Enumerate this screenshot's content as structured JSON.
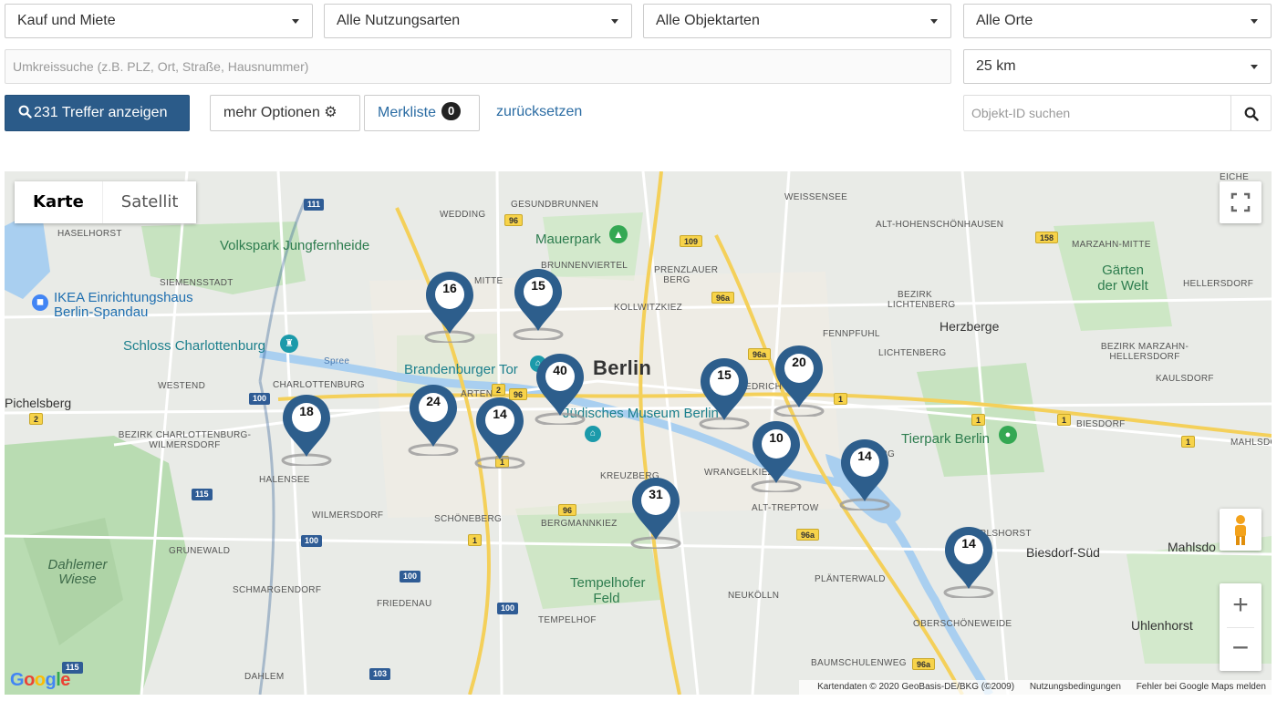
{
  "filters": {
    "row1": [
      "Kauf und Miete",
      "Alle Nutzungsarten",
      "Alle Objektarten",
      "Alle Orte"
    ],
    "radius_placeholder": "Umkreissuche (z.B. PLZ, Ort, Straße, Hausnummer)",
    "radius_value": "25 km"
  },
  "actions": {
    "show_results": "231 Treffer anzeigen",
    "more_options": "mehr Optionen",
    "watchlist": "Merkliste",
    "watchlist_count": "0",
    "reset": "zurücksetzen",
    "object_id_placeholder": "Objekt-ID suchen"
  },
  "map": {
    "type_map": "Karte",
    "type_satellite": "Satellit",
    "attribution": "Kartendaten © 2020 GeoBasis-DE/BKG (©2009)",
    "terms": "Nutzungsbedingungen",
    "report": "Fehler bei Google Maps melden",
    "logo": "Google",
    "clusters": [
      "16",
      "15",
      "40",
      "15",
      "20",
      "18",
      "24",
      "14",
      "10",
      "14",
      "31",
      "14"
    ],
    "colors": {
      "marker": "#2d5e8c",
      "water": "#a9cff0",
      "park": "#c7e3c0",
      "road": "#ffffff",
      "highway": "#f7d34a"
    },
    "labels": {
      "berlin": "Berlin",
      "volkspark": "Volkspark Jungfernheide",
      "ikea": "IKEA Einrichtungshaus Berlin-Spandau",
      "schloss": "Schloss Charlottenburg",
      "brandenburger": "Brandenburger Tor",
      "museum": "Jüdisches Museum Berlin",
      "mauerpark": "Mauerpark",
      "tierpark": "Tierpark Berlin",
      "gaerten": "Gärten der Welt",
      "herzberge": "Herzberge",
      "tempelhof": "Tempelhofer Feld",
      "dahlem_wiese": "Dahlemer Wiese",
      "pichelsberg": "Pichelsberg",
      "biesdorf_sued": "Biesdorf-Süd",
      "uhlenhorst": "Uhlenhorst",
      "mahlsdo": "Mahlsdo",
      "spree": "Spree",
      "wedding": "WEDDING",
      "gesundbrunnen": "GESUNDBRUNNEN",
      "weissensee": "WEISSENSEE",
      "hohenschoenhausen": "ALT-HOHENSCHÖNHAUSEN",
      "marzahn_mitte": "MARZAHN-MITTE",
      "eiche": "EICHE",
      "haselhorst": "HASELHORST",
      "siemensstadt": "SIEMENSSTADT",
      "brunnenviertel": "BRUNNENVIERTEL",
      "prenzlauer": "PRENZLAUER BERG",
      "kollwitzkiez": "KOLLWITZKIEZ",
      "mitte": "MITTE",
      "fennpfuhl": "FENNPFUHL",
      "lichtenberg_bezirk": "BEZIRK LICHTENBERG",
      "lichtenberg": "LICHTENBERG",
      "hellersdorf": "HELLERSDORF",
      "marzahn_hellersdorf": "BEZIRK MARZAHN-HELLERSDORF",
      "kaulsdorf": "KAULSDORF",
      "biesdorf": "BIESDORF",
      "mahlsdorf": "MAHLSDORF",
      "westend": "WESTEND",
      "charlottenburg": "CHARLOTTENBURG",
      "charl_wilm": "BEZIRK CHARLOTTENBURG-WILMERSDORF",
      "halensee": "HALENSEE",
      "wilmersdorf": "WILMERSDORF",
      "grunewald": "GRUNEWALD",
      "schmargendorf": "SCHMARGENDORF",
      "dahlem": "DAHLEM",
      "friedenau": "FRIEDENAU",
      "schoeneberg": "SCHÖNEBERG",
      "tempelhof_d": "TEMPELHOF",
      "kreuzberg": "KREUZBERG",
      "bergmannkiez": "BERGMANNKIEZ",
      "wrangelkiez": "WRANGELKIEZ",
      "alt_treptow": "ALT-TREPTOW",
      "plaenterwald": "PLÄNTERWALD",
      "neukoelln": "NEUKÖLLN",
      "oberschoeneweide": "OBERSCHÖNEWEIDE",
      "baumschulenweg": "BAUMSCHULENWEG",
      "karlshorst": "KARLSHORST",
      "arten": "ARTEN",
      "edrich": "EDRICH",
      "burg": "BURG"
    },
    "shields": [
      "111",
      "96",
      "109",
      "158",
      "96a",
      "96a",
      "96a",
      "96a",
      "2",
      "96",
      "100",
      "2",
      "115",
      "100",
      "100",
      "100",
      "96",
      "1",
      "1",
      "1",
      "1",
      "1",
      "1",
      "103",
      "115"
    ]
  }
}
